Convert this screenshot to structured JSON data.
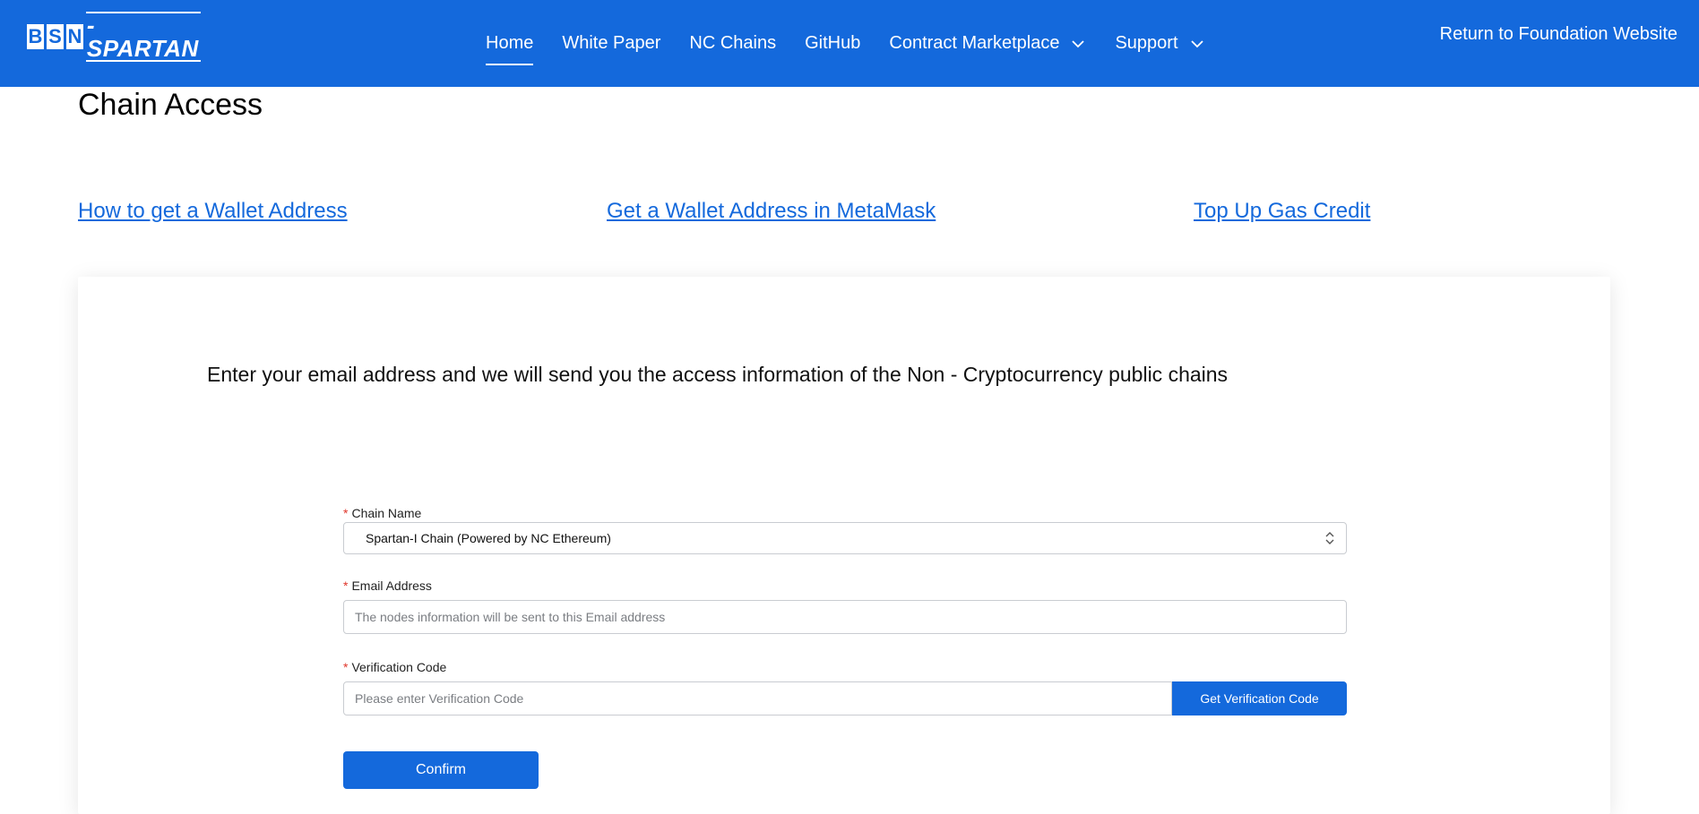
{
  "header": {
    "logo": {
      "box_letters": [
        "B",
        "S",
        "N"
      ],
      "rest": "-SPARTAN"
    },
    "nav": [
      {
        "label": "Home",
        "active": true,
        "dropdown": false
      },
      {
        "label": "White Paper",
        "active": false,
        "dropdown": false
      },
      {
        "label": "NC Chains",
        "active": false,
        "dropdown": false
      },
      {
        "label": "GitHub",
        "active": false,
        "dropdown": false
      },
      {
        "label": "Contract Marketplace",
        "active": false,
        "dropdown": true
      },
      {
        "label": "Support",
        "active": false,
        "dropdown": true
      }
    ],
    "return_link": "Return to Foundation Website"
  },
  "page": {
    "title": "Chain Access",
    "links": [
      "How to get a Wallet Address",
      "Get a Wallet Address in MetaMask",
      "Top Up Gas Credit"
    ]
  },
  "card": {
    "heading": "Enter your email address and we will send you the access information of the Non - Cryptocurrency public chains",
    "form": {
      "required_mark": "*",
      "chain_name": {
        "label": "Chain Name",
        "value": "Spartan-I Chain (Powered by NC Ethereum)"
      },
      "email": {
        "label": "Email Address",
        "value": "",
        "placeholder": "The nodes information will be sent to this Email address"
      },
      "verification": {
        "label": "Verification Code",
        "value": "",
        "placeholder": "Please enter Verification Code",
        "button": "Get Verification Code"
      },
      "confirm": "Confirm"
    }
  },
  "colors": {
    "primary": "#1469dc",
    "required": "#e0362b",
    "background": "#ffffff"
  },
  "icons": {
    "nav_dropdown": "chevron-down-icon",
    "select": "select-arrows-icon"
  }
}
